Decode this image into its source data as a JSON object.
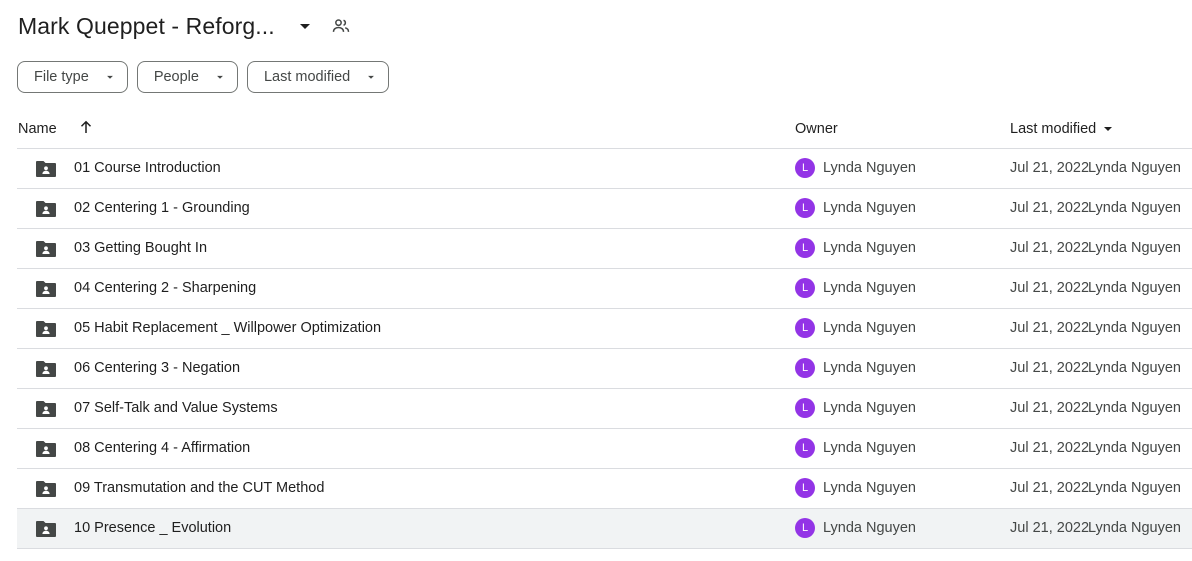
{
  "title": {
    "text": "Mark Queppet - Reforg...",
    "caret_icon": "arrow-drop-down-icon",
    "share_icon": "shared-people-icon"
  },
  "filters": [
    {
      "label": "File type"
    },
    {
      "label": "People"
    },
    {
      "label": "Last modified"
    }
  ],
  "table": {
    "headers": {
      "name": "Name",
      "owner": "Owner",
      "last_modified": "Last modified"
    },
    "sort_icon": "arrow-upward-icon",
    "rows": [
      {
        "name": "01 Course Introduction",
        "owner": "Lynda Nguyen",
        "avatar": "L",
        "date": "Jul 21, 2022",
        "modified_by": "Lynda Nguyen"
      },
      {
        "name": "02 Centering 1 - Grounding",
        "owner": "Lynda Nguyen",
        "avatar": "L",
        "date": "Jul 21, 2022",
        "modified_by": "Lynda Nguyen"
      },
      {
        "name": "03 Getting Bought In",
        "owner": "Lynda Nguyen",
        "avatar": "L",
        "date": "Jul 21, 2022",
        "modified_by": "Lynda Nguyen"
      },
      {
        "name": "04 Centering 2 - Sharpening",
        "owner": "Lynda Nguyen",
        "avatar": "L",
        "date": "Jul 21, 2022",
        "modified_by": "Lynda Nguyen"
      },
      {
        "name": "05 Habit Replacement _ Willpower Optimization",
        "owner": "Lynda Nguyen",
        "avatar": "L",
        "date": "Jul 21, 2022",
        "modified_by": "Lynda Nguyen"
      },
      {
        "name": "06 Centering 3 - Negation",
        "owner": "Lynda Nguyen",
        "avatar": "L",
        "date": "Jul 21, 2022",
        "modified_by": "Lynda Nguyen"
      },
      {
        "name": "07 Self-Talk and Value Systems",
        "owner": "Lynda Nguyen",
        "avatar": "L",
        "date": "Jul 21, 2022",
        "modified_by": "Lynda Nguyen"
      },
      {
        "name": "08 Centering 4 - Affirmation",
        "owner": "Lynda Nguyen",
        "avatar": "L",
        "date": "Jul 21, 2022",
        "modified_by": "Lynda Nguyen"
      },
      {
        "name": "09 Transmutation and the CUT Method",
        "owner": "Lynda Nguyen",
        "avatar": "L",
        "date": "Jul 21, 2022",
        "modified_by": "Lynda Nguyen"
      },
      {
        "name": "10 Presence _ Evolution",
        "owner": "Lynda Nguyen",
        "avatar": "L",
        "date": "Jul 21, 2022",
        "modified_by": "Lynda Nguyen"
      }
    ]
  },
  "colors": {
    "avatar": "#9334e6",
    "folder_icon": "#444746",
    "selected_row": "#f1f3f4",
    "divider": "#dadce0"
  },
  "icons": {
    "row_icon": "shared-folder-icon"
  }
}
